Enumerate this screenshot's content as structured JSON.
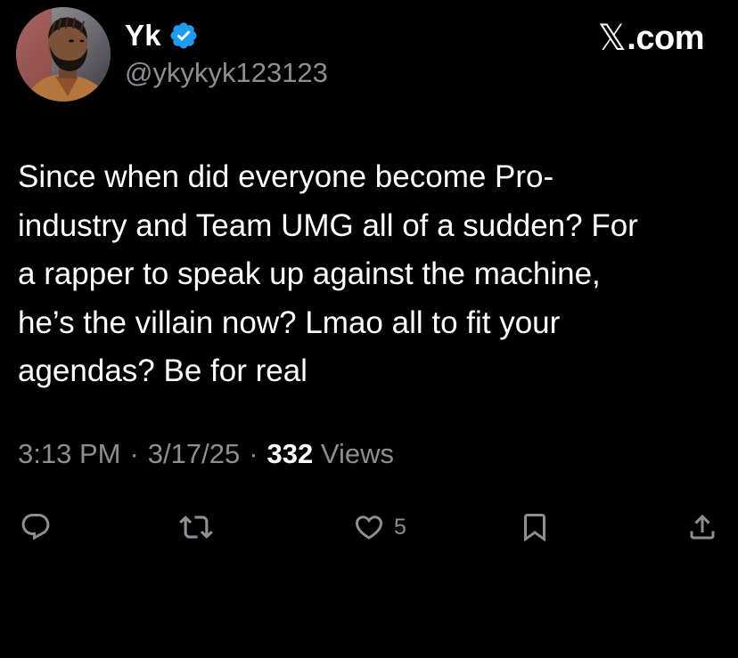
{
  "author": {
    "display_name": "Yk",
    "handle": "@ykykyk123123",
    "verified": true,
    "avatar_icon": "profile-photo"
  },
  "brand": {
    "x_glyph": "𝕏",
    "suffix": ".com"
  },
  "tweet": {
    "text": "Since when did everyone become Pro-\nindustry and Team UMG all of a sudden? For\na rapper to speak up against the machine,\nhe’s the villain now? Lmao all to fit your\nagendas? Be for real"
  },
  "meta": {
    "time": "3:13 PM",
    "sep1": "·",
    "date": "3/17/25",
    "sep2": "·",
    "views_count": "332",
    "views_label": "Views"
  },
  "actions": {
    "reply": {
      "icon": "reply-icon",
      "count": ""
    },
    "repost": {
      "icon": "repost-icon",
      "count": ""
    },
    "like": {
      "icon": "heart-icon",
      "count": "5"
    },
    "bookmark": {
      "icon": "bookmark-icon",
      "count": ""
    },
    "share": {
      "icon": "share-icon",
      "count": ""
    }
  },
  "colors": {
    "background": "#000000",
    "text": "#ffffff",
    "secondary": "#8b8f94",
    "verified_badge": "#1d9bf0"
  }
}
